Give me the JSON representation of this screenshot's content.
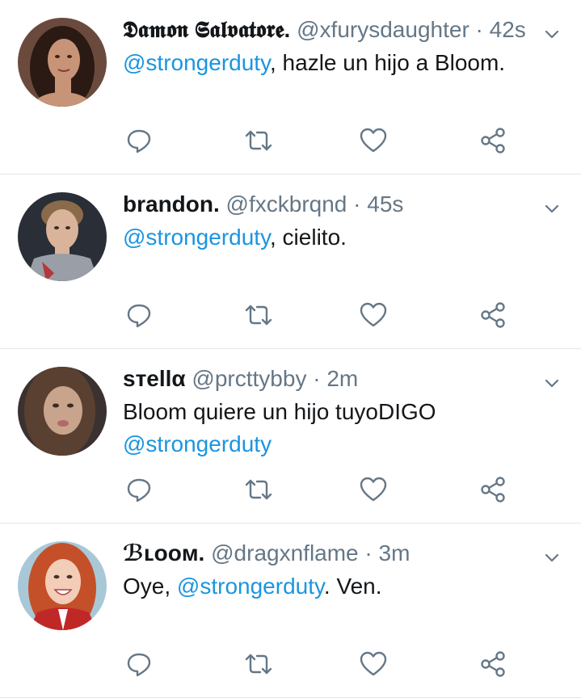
{
  "tweets": [
    {
      "name": "𝕯𝖆𝖒𝖔𝖓 𝕾𝖆𝖑𝖛𝖆𝖙𝖔𝖗𝖊.",
      "handle": "@xfurysdaughter",
      "sep": "·",
      "time": "42s",
      "mention": "@strongerduty",
      "text_after": ", hazle un hijo a Bloom.",
      "text_before": "",
      "avatar": {
        "skin": "#c89478",
        "hair": "#2b1a14",
        "bg": "#6b4a3e"
      }
    },
    {
      "name": "brandon.",
      "handle": "@fxckbrqnd",
      "sep": "·",
      "time": "45s",
      "mention": "@strongerduty",
      "text_after": ", cielito.",
      "text_before": "",
      "avatar": {
        "skin": "#d9b39a",
        "hair": "#8a6a4a",
        "bg": "#2a2e36"
      }
    },
    {
      "name": "ѕтellα",
      "handle": "@prcttybby",
      "sep": "·",
      "time": "2m",
      "text_before": "Bloom quiere un hijo tuyoDIGO",
      "mention": "@strongerduty",
      "text_after": "",
      "avatar": {
        "skin": "#c9a48c",
        "hair": "#5a4030",
        "bg": "#3a3230"
      }
    },
    {
      "name": "ℬʟᴏᴏᴍ.",
      "handle": "@dragxnflame",
      "sep": "·",
      "time": "3m",
      "text_before": "Oye, ",
      "mention": "@strongerduty",
      "text_after": ". Ven.",
      "avatar": {
        "skin": "#f2cdb8",
        "hair": "#c4502a",
        "bg": "#a8c8d8"
      }
    }
  ],
  "icons": {
    "reply": "reply-icon",
    "retweet": "retweet-icon",
    "like": "heart-icon",
    "share": "share-icon",
    "caret": "chevron-down-icon"
  },
  "colors": {
    "mention": "#1b95e0",
    "secondary": "#657786",
    "divider": "#e1e8ed"
  }
}
